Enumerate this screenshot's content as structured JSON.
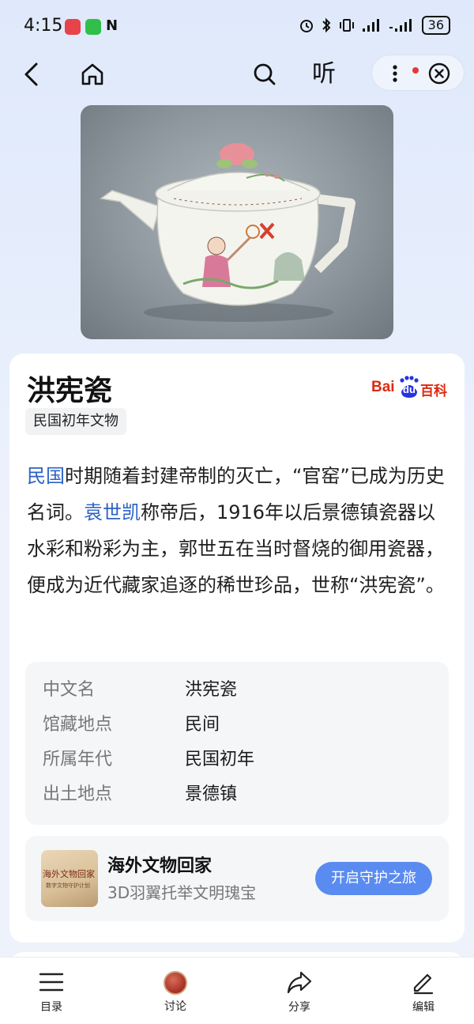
{
  "status_bar": {
    "time": "4:15",
    "battery": "36"
  },
  "nav": {
    "listen_label": "听"
  },
  "article": {
    "title": "洪宪瓷",
    "tag": "民国初年文物",
    "source_logo": {
      "text": "Baidu百科",
      "part1": "Bai",
      "part2": "du",
      "part3": "百科"
    },
    "description": {
      "link1": "民国",
      "text1": "时期随着封建帝制的灭亡，“官窑”已成为历史名词。",
      "link2": "袁世凯",
      "text2": "称帝后，1916年以后景德镇瓷器以水彩和粉彩为主，郭世五在当时督烧的御用瓷器，便成为近代藏家追逐的稀世珍品，世称“洪宪瓷”。"
    },
    "info": [
      {
        "key": "中文名",
        "value": "洪宪瓷"
      },
      {
        "key": "馆藏地点",
        "value": "民间"
      },
      {
        "key": "所属年代",
        "value": "民国初年"
      },
      {
        "key": "出土地点",
        "value": "景德镇"
      }
    ],
    "promo": {
      "thumb_title": "海外文物回家",
      "thumb_subtitle": "数字文物守护计划",
      "title": "海外文物回家",
      "subtitle": "3D羽翼托举文明瑰宝",
      "button": "开启守护之旅"
    }
  },
  "bottom_bar": {
    "tabs": [
      {
        "label": "目录",
        "icon": "list-icon"
      },
      {
        "label": "讨论",
        "icon": "seal-icon"
      },
      {
        "label": "分享",
        "icon": "share-icon"
      },
      {
        "label": "编辑",
        "icon": "edit-icon"
      }
    ]
  },
  "colors": {
    "link": "#2b62c4",
    "button": "#5a8bf0",
    "baidu_red": "#de2910",
    "baidu_blue": "#2932e1"
  }
}
